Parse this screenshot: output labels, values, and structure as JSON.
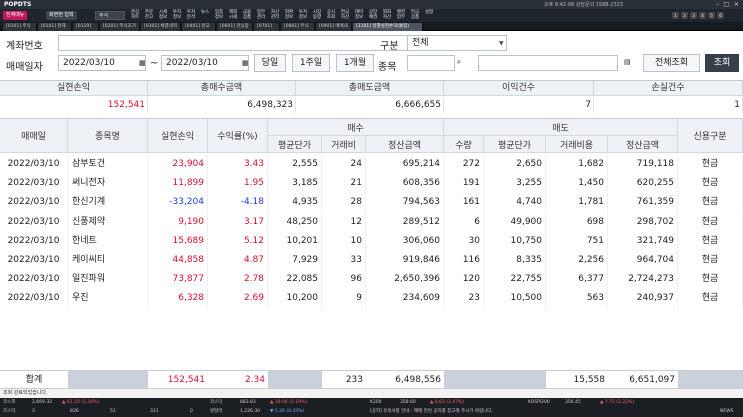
{
  "titlebar": {
    "logo": "POPDTS",
    "info": "오후 8:42:08   상담문의 1588-2323"
  },
  "menubar": {
    "brand": "전체메뉴",
    "screen_input": "화면번 입력",
    "combo": "주식",
    "items": [
      "관심 차트",
      "주문 잔고",
      "시세 정보",
      "투자 정보",
      "투자 분석",
      "뉴스",
      "업종 정보",
      "해외 시세",
      "금융 상품",
      "업무 관리",
      "자산 관리",
      "외환 정보",
      "투자 정보",
      "시장 동향",
      "공시 조회",
      "연금 자산",
      "테마 정보",
      "상장 채권",
      "외화 자산",
      "뱅킹 업무",
      "연금 상품",
      "설정"
    ],
    "pages": [
      "1",
      "2",
      "3",
      "4",
      "5",
      "6"
    ]
  },
  "tabs": [
    "[0101] 주식종합",
    "[0101] 현재가",
    "[0119] 차트",
    "[0201] 주식호가",
    "[0301] 체결내역",
    "[0401] 잔고현황",
    "[0601] 관심종목",
    "[0701] 주문",
    "[0801] 주식주문",
    "[0901] 매매내역",
    "[1101] 일별실현손익(통합)"
  ],
  "form": {
    "account_label": "계좌번호",
    "account_value": "",
    "category_label": "구분",
    "category_value": "전체",
    "period_label": "매매일자",
    "date_from": "2022/03/10",
    "tilde": "~",
    "date_to": "2022/03/10",
    "btn_day": "당일",
    "btn_week": "1주일",
    "btn_month": "1개월",
    "stock_label": "종목",
    "btn_query_all": "전체조회",
    "btn_query": "조회"
  },
  "summary": {
    "headers": [
      "실현손익",
      "총매수금액",
      "총매도금액",
      "이익건수",
      "손실건수"
    ],
    "values": [
      "152,541",
      "6,498,323",
      "6,666,655",
      "7",
      "1"
    ]
  },
  "grid": {
    "headers": {
      "date": "매매일",
      "name": "종목명",
      "pnl": "실현손익",
      "rate": "수익률(%)",
      "buy": "매수",
      "sell": "매도",
      "credit": "신용구분",
      "buy_sub": [
        "평균단가",
        "거래비",
        "정산금액"
      ],
      "sell_sub": [
        "수량",
        "평균단가",
        "거래비용",
        "정산금액"
      ]
    },
    "rows": [
      {
        "date": "2022/03/10",
        "name": "삼부토건",
        "pnl": "23,904",
        "rate": "3.43",
        "buy_avg": "2,555",
        "buy_fee": "24",
        "buy_amt": "695,214",
        "qty": "272",
        "sell_avg": "2,650",
        "sell_fee": "1,682",
        "sell_amt": "719,118",
        "credit": "현금",
        "sign": "red"
      },
      {
        "date": "2022/03/10",
        "name": "써니전자",
        "pnl": "11,899",
        "rate": "1.95",
        "buy_avg": "3,185",
        "buy_fee": "21",
        "buy_amt": "608,356",
        "qty": "191",
        "sell_avg": "3,255",
        "sell_fee": "1,450",
        "sell_amt": "620,255",
        "credit": "현금",
        "sign": "red"
      },
      {
        "date": "2022/03/10",
        "name": "한신기계",
        "pnl": "-33,204",
        "rate": "-4.18",
        "buy_avg": "4,935",
        "buy_fee": "28",
        "buy_amt": "794,563",
        "qty": "161",
        "sell_avg": "4,740",
        "sell_fee": "1,781",
        "sell_amt": "761,359",
        "credit": "현금",
        "sign": "blue"
      },
      {
        "date": "2022/03/10",
        "name": "신풍제약",
        "pnl": "9,190",
        "rate": "3.17",
        "buy_avg": "48,250",
        "buy_fee": "12",
        "buy_amt": "289,512",
        "qty": "6",
        "sell_avg": "49,900",
        "sell_fee": "698",
        "sell_amt": "298,702",
        "credit": "현금",
        "sign": "red"
      },
      {
        "date": "2022/03/10",
        "name": "한네트",
        "pnl": "15,689",
        "rate": "5.12",
        "buy_avg": "10,201",
        "buy_fee": "10",
        "buy_amt": "306,060",
        "qty": "30",
        "sell_avg": "10,750",
        "sell_fee": "751",
        "sell_amt": "321,749",
        "credit": "현금",
        "sign": "red"
      },
      {
        "date": "2022/03/10",
        "name": "케이씨티",
        "pnl": "44,858",
        "rate": "4.87",
        "buy_avg": "7,929",
        "buy_fee": "33",
        "buy_amt": "919,846",
        "qty": "116",
        "sell_avg": "8,335",
        "sell_fee": "2,256",
        "sell_amt": "964,704",
        "credit": "현금",
        "sign": "red"
      },
      {
        "date": "2022/03/10",
        "name": "일진파워",
        "pnl": "73,877",
        "rate": "2.78",
        "buy_avg": "22,085",
        "buy_fee": "96",
        "buy_amt": "2,650,396",
        "qty": "120",
        "sell_avg": "22,755",
        "sell_fee": "6,377",
        "sell_amt": "2,724,273",
        "credit": "현금",
        "sign": "red"
      },
      {
        "date": "2022/03/10",
        "name": "우진",
        "pnl": "6,328",
        "rate": "2.69",
        "buy_avg": "10,200",
        "buy_fee": "9",
        "buy_amt": "234,609",
        "qty": "23",
        "sell_avg": "10,500",
        "sell_fee": "563",
        "sell_amt": "240,937",
        "credit": "현금",
        "sign": "red"
      }
    ]
  },
  "totals": {
    "label": "합계",
    "pnl": "152,541",
    "rate": "2.34",
    "buy_fee": "233",
    "buy_amt": "6,498,556",
    "sell_fee": "15,558",
    "sell_amt": "6,651,097"
  },
  "status": {
    "text": "조회 완료되었습니다."
  },
  "ticker": {
    "row1": [
      "코스피",
      "2,669.32",
      "▲ 61.10 (2.34%)",
      "코스닥",
      "883.83",
      "▲ 18.94 (2.19%)",
      "K200",
      "358.60",
      "▲ 8.63 (2.47%)",
      "KOSPI200",
      "356.45",
      "▲ 7.75 (2.22%)"
    ],
    "row2": [
      "코스닥",
      "3",
      "836",
      "51",
      "311",
      "0",
      "원달러",
      "1,226.30",
      "▼ 5.30 (0.43%)",
      "[공지] 유의사항 안내 : 매매 관련 공지를 참고해 주시기 바랍니다.",
      "NEWS"
    ]
  },
  "colors": {
    "up": "#d8102e",
    "down": "#1a3ed8",
    "accent": "#c2185b"
  }
}
